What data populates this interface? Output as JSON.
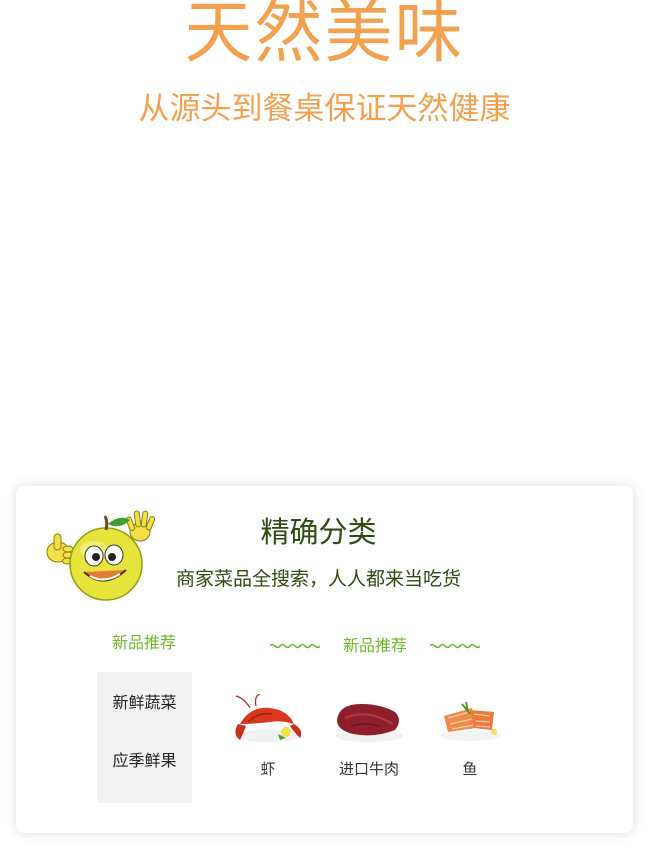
{
  "hero": {
    "title": "天然美味",
    "subtitle": "从源头到餐桌保证天然健康"
  },
  "card": {
    "title": "精确分类",
    "subtitle": "商家菜品全搜索，人人都来当吃货",
    "sidebar": {
      "heading": "新品推荐",
      "items": [
        {
          "label": "新鲜蔬菜"
        },
        {
          "label": "应季鲜果"
        }
      ]
    },
    "recommend": {
      "title": "新品推荐",
      "products": [
        {
          "label": "虾",
          "icon": "shrimp-icon"
        },
        {
          "label": "进口牛肉",
          "icon": "beef-icon"
        },
        {
          "label": "鱼",
          "icon": "fish-icon"
        }
      ]
    }
  },
  "colors": {
    "hero_orange": "#f3a04f",
    "accent_green": "#6fba2c",
    "dark_green": "#2f4a12"
  }
}
